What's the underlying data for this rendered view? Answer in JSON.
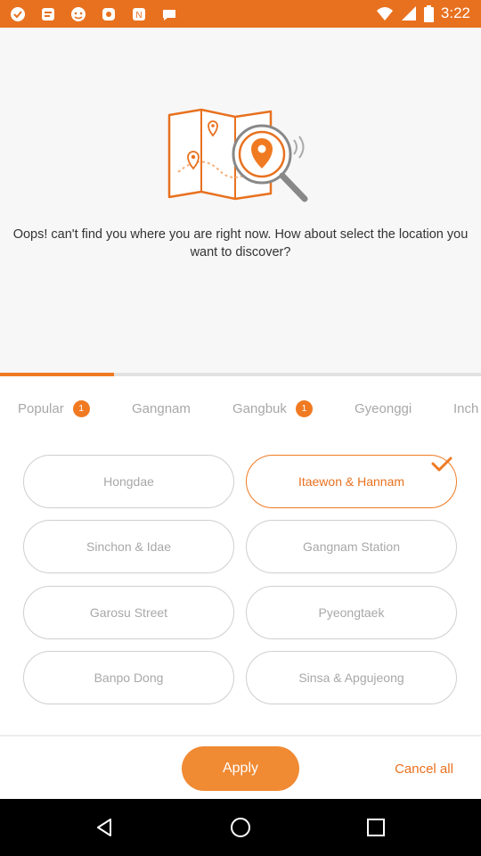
{
  "status_bar": {
    "time": "3:22",
    "left_icons": [
      "notification-dot-icon",
      "notification-dot-icon",
      "notification-dot-icon",
      "notification-dot-icon",
      "notification-dot-icon",
      "notification-dot-icon"
    ],
    "right_icons": [
      "wifi-icon",
      "signal-icon",
      "battery-icon"
    ]
  },
  "hero": {
    "illustration": "map-search-icon",
    "message": "Oops! can't find you where you are right now. How about select the location you want to discover?"
  },
  "progress": {
    "fraction": 0.237,
    "color": "#f07a22"
  },
  "tabs": [
    {
      "label": "Popular",
      "badge": "1",
      "active": true
    },
    {
      "label": "Gangnam",
      "badge": "",
      "active": false
    },
    {
      "label": "Gangbuk",
      "badge": "1",
      "active": false
    },
    {
      "label": "Gyeonggi",
      "badge": "",
      "active": false
    },
    {
      "label": "Inch",
      "badge": "",
      "active": false
    }
  ],
  "locations": [
    {
      "label": "Hongdae",
      "selected": false
    },
    {
      "label": "Itaewon & Hannam",
      "selected": true
    },
    {
      "label": "Sinchon & Idae",
      "selected": false
    },
    {
      "label": "Gangnam Station",
      "selected": false
    },
    {
      "label": "Garosu Street",
      "selected": false
    },
    {
      "label": "Pyeongtaek",
      "selected": false
    },
    {
      "label": "Banpo Dong",
      "selected": false
    },
    {
      "label": "Sinsa & Apgujeong",
      "selected": false
    }
  ],
  "footer": {
    "apply_label": "Apply",
    "cancel_label": "Cancel all"
  },
  "colors": {
    "accent": "#e8711f",
    "apply_bg": "#f08a33",
    "hero_bg": "#f7f7f7"
  },
  "nav_bar": [
    "back-icon",
    "home-icon",
    "recents-icon"
  ]
}
